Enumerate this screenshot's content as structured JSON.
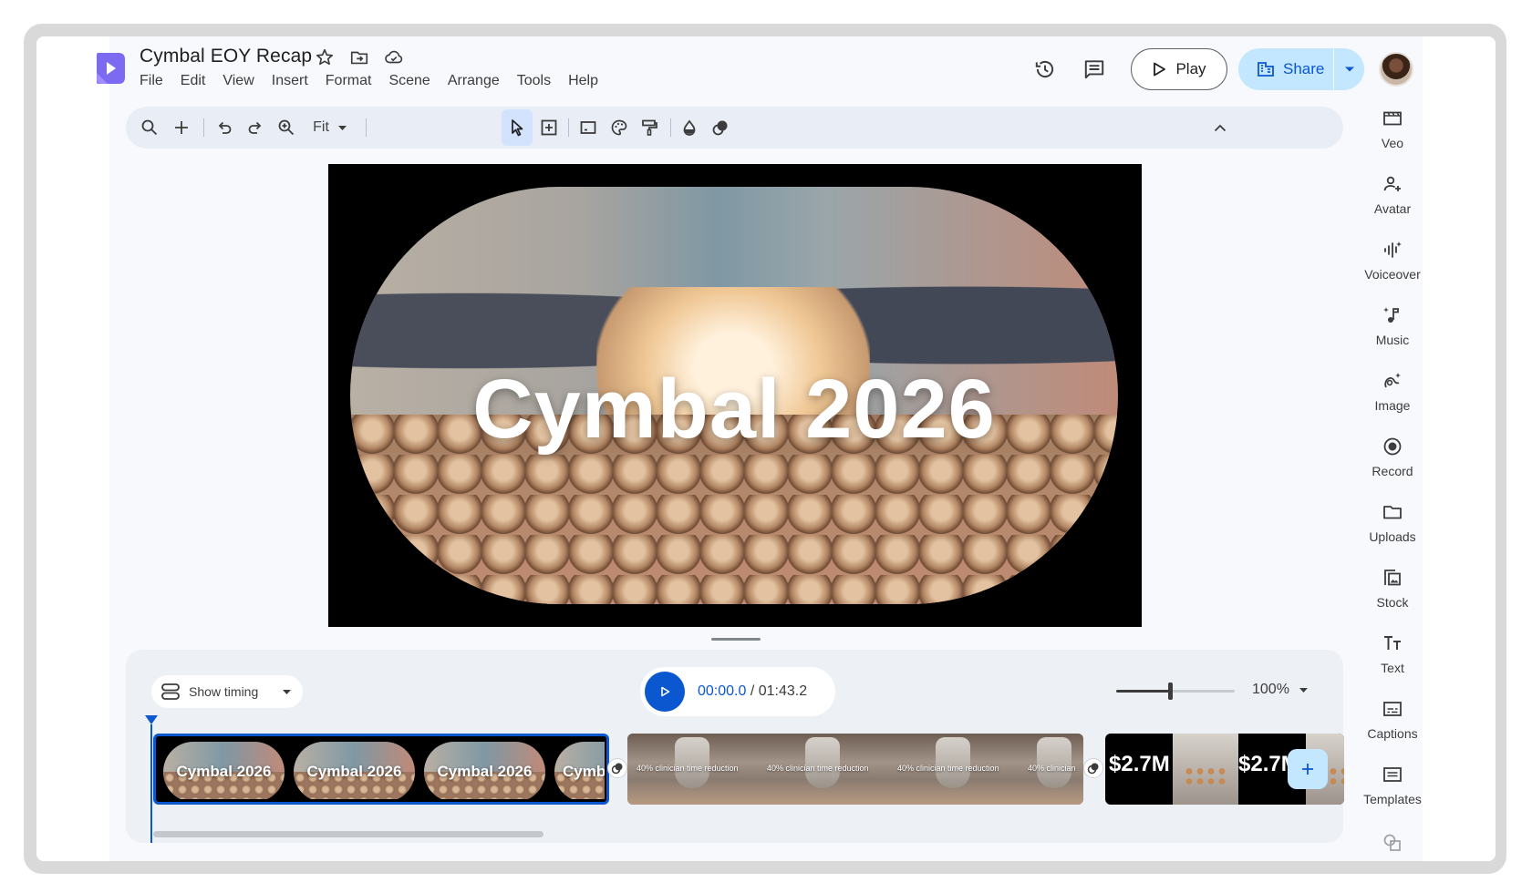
{
  "document": {
    "title": "Cymbal EOY Recap"
  },
  "menu": [
    "File",
    "Edit",
    "View",
    "Insert",
    "Format",
    "Scene",
    "Arrange",
    "Tools",
    "Help"
  ],
  "header": {
    "play_label": "Play",
    "share_label": "Share"
  },
  "toolbar": {
    "zoom_label": "Fit"
  },
  "stage": {
    "title_text": "Cymbal 2026"
  },
  "timeline": {
    "show_timing_label": "Show timing",
    "current_time": "00:00.0",
    "separator": " / ",
    "total_time": "01:43.2",
    "zoom_percent": "100%",
    "zoom_level_fraction": 0.45,
    "clips": [
      {
        "thumb_texts": [
          "Cymbal 2026",
          "Cymbal 2026",
          "Cymbal 2026",
          "Cymb"
        ]
      },
      {
        "thumb_texts": [
          "40% clinician time reduction",
          "40% clinician time reduction",
          "40% clinician time reduction",
          "40% clinician"
        ]
      },
      {
        "thumb_texts": [
          "$2.7M",
          "$2.7M"
        ]
      }
    ]
  },
  "rail": [
    {
      "label": "Veo",
      "icon": "veo-icon"
    },
    {
      "label": "Avatar",
      "icon": "avatar-icon"
    },
    {
      "label": "Voiceover",
      "icon": "voiceover-icon"
    },
    {
      "label": "Music",
      "icon": "music-icon"
    },
    {
      "label": "Image",
      "icon": "image-icon"
    },
    {
      "label": "Record",
      "icon": "record-icon"
    },
    {
      "label": "Uploads",
      "icon": "folder-icon"
    },
    {
      "label": "Stock",
      "icon": "stock-icon"
    },
    {
      "label": "Text",
      "icon": "text-icon"
    },
    {
      "label": "Captions",
      "icon": "captions-icon"
    },
    {
      "label": "Templates",
      "icon": "templates-icon"
    }
  ],
  "colors": {
    "accent": "#0b57d0",
    "share_bg": "#c2e7ff",
    "toolbar_bg": "#e9eef6"
  }
}
